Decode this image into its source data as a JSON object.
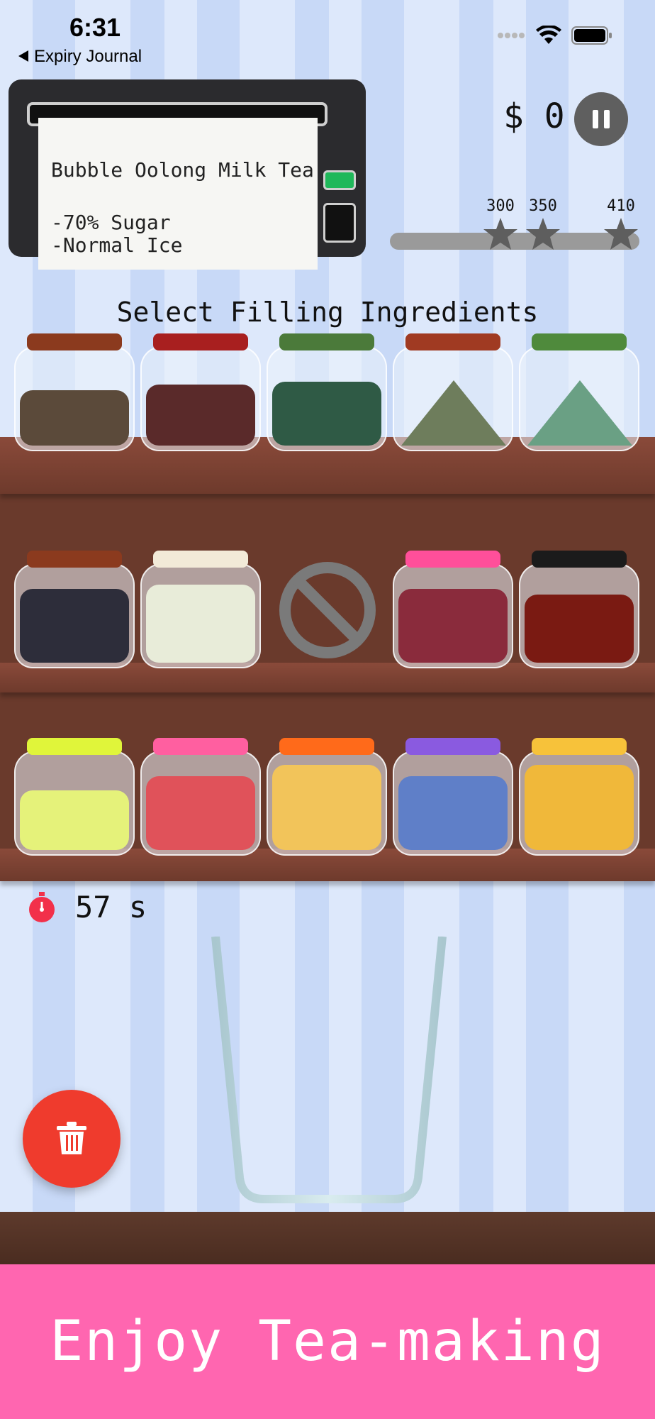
{
  "status_bar": {
    "time": "6:31",
    "back_label": "Expiry Journal"
  },
  "order": {
    "drink": "Bubble Oolong Milk Tea",
    "sugar": "-70% Sugar",
    "ice": "-Normal Ice"
  },
  "money": "$ 0",
  "progress": {
    "value": 0,
    "milestones": [
      "300",
      "350",
      "410"
    ]
  },
  "section_title": "Select Filling Ingredients",
  "shelves": [
    {
      "row": "tea-bags-and-powders",
      "items": [
        {
          "name": "black-tea-bags-jar",
          "lid": "#8b3a1e",
          "fill": "#5b4a3a"
        },
        {
          "name": "red-tea-bags-jar",
          "lid": "#a81f1f",
          "fill": "#5a2a2a"
        },
        {
          "name": "green-tea-bags-jar",
          "lid": "#4b7a3a",
          "fill": "#2f5a45"
        },
        {
          "name": "matcha-powder-jar",
          "lid": "#a03a22",
          "fill": "#6e7d5c"
        },
        {
          "name": "green-powder-jar",
          "lid": "#4f8a3c",
          "fill": "#6aa084"
        }
      ]
    },
    {
      "row": "toppings",
      "items": [
        {
          "name": "black-pearls-jar",
          "lid": "#8b3a1e",
          "fill": "#2d2d3a"
        },
        {
          "name": "white-pearls-jar",
          "lid": "#f2ead8",
          "fill": "#e8ecd9"
        },
        {
          "name": "empty-slot",
          "lid": "",
          "fill": ""
        },
        {
          "name": "red-beans-jar",
          "lid": "#ff4f9a",
          "fill": "#8a2b3c"
        },
        {
          "name": "red-jelly-jar",
          "lid": "#1b1b1b",
          "fill": "#7a1a12"
        }
      ]
    },
    {
      "row": "fruits",
      "items": [
        {
          "name": "lemon-slices-jar",
          "lid": "#e0f53a",
          "fill": "#e5f27a"
        },
        {
          "name": "strawberry-slices-jar",
          "lid": "#ff5fa0",
          "fill": "#e0525a"
        },
        {
          "name": "mango-strips-jar",
          "lid": "#ff6a1a",
          "fill": "#f2c45a"
        },
        {
          "name": "blueberries-jar",
          "lid": "#8a5ae0",
          "fill": "#5f7fc8"
        },
        {
          "name": "peach-slices-jar",
          "lid": "#f7c23a",
          "fill": "#f0b83a"
        }
      ]
    }
  ],
  "timer": "57 s",
  "banner": "Enjoy Tea-making",
  "icons": {
    "back": "back-triangle-icon",
    "wifi": "wifi-icon",
    "battery": "battery-icon",
    "pause": "pause-icon",
    "star": "star-icon",
    "stopwatch": "stopwatch-icon",
    "trash": "trash-icon",
    "no-entry": "no-entry-icon"
  }
}
